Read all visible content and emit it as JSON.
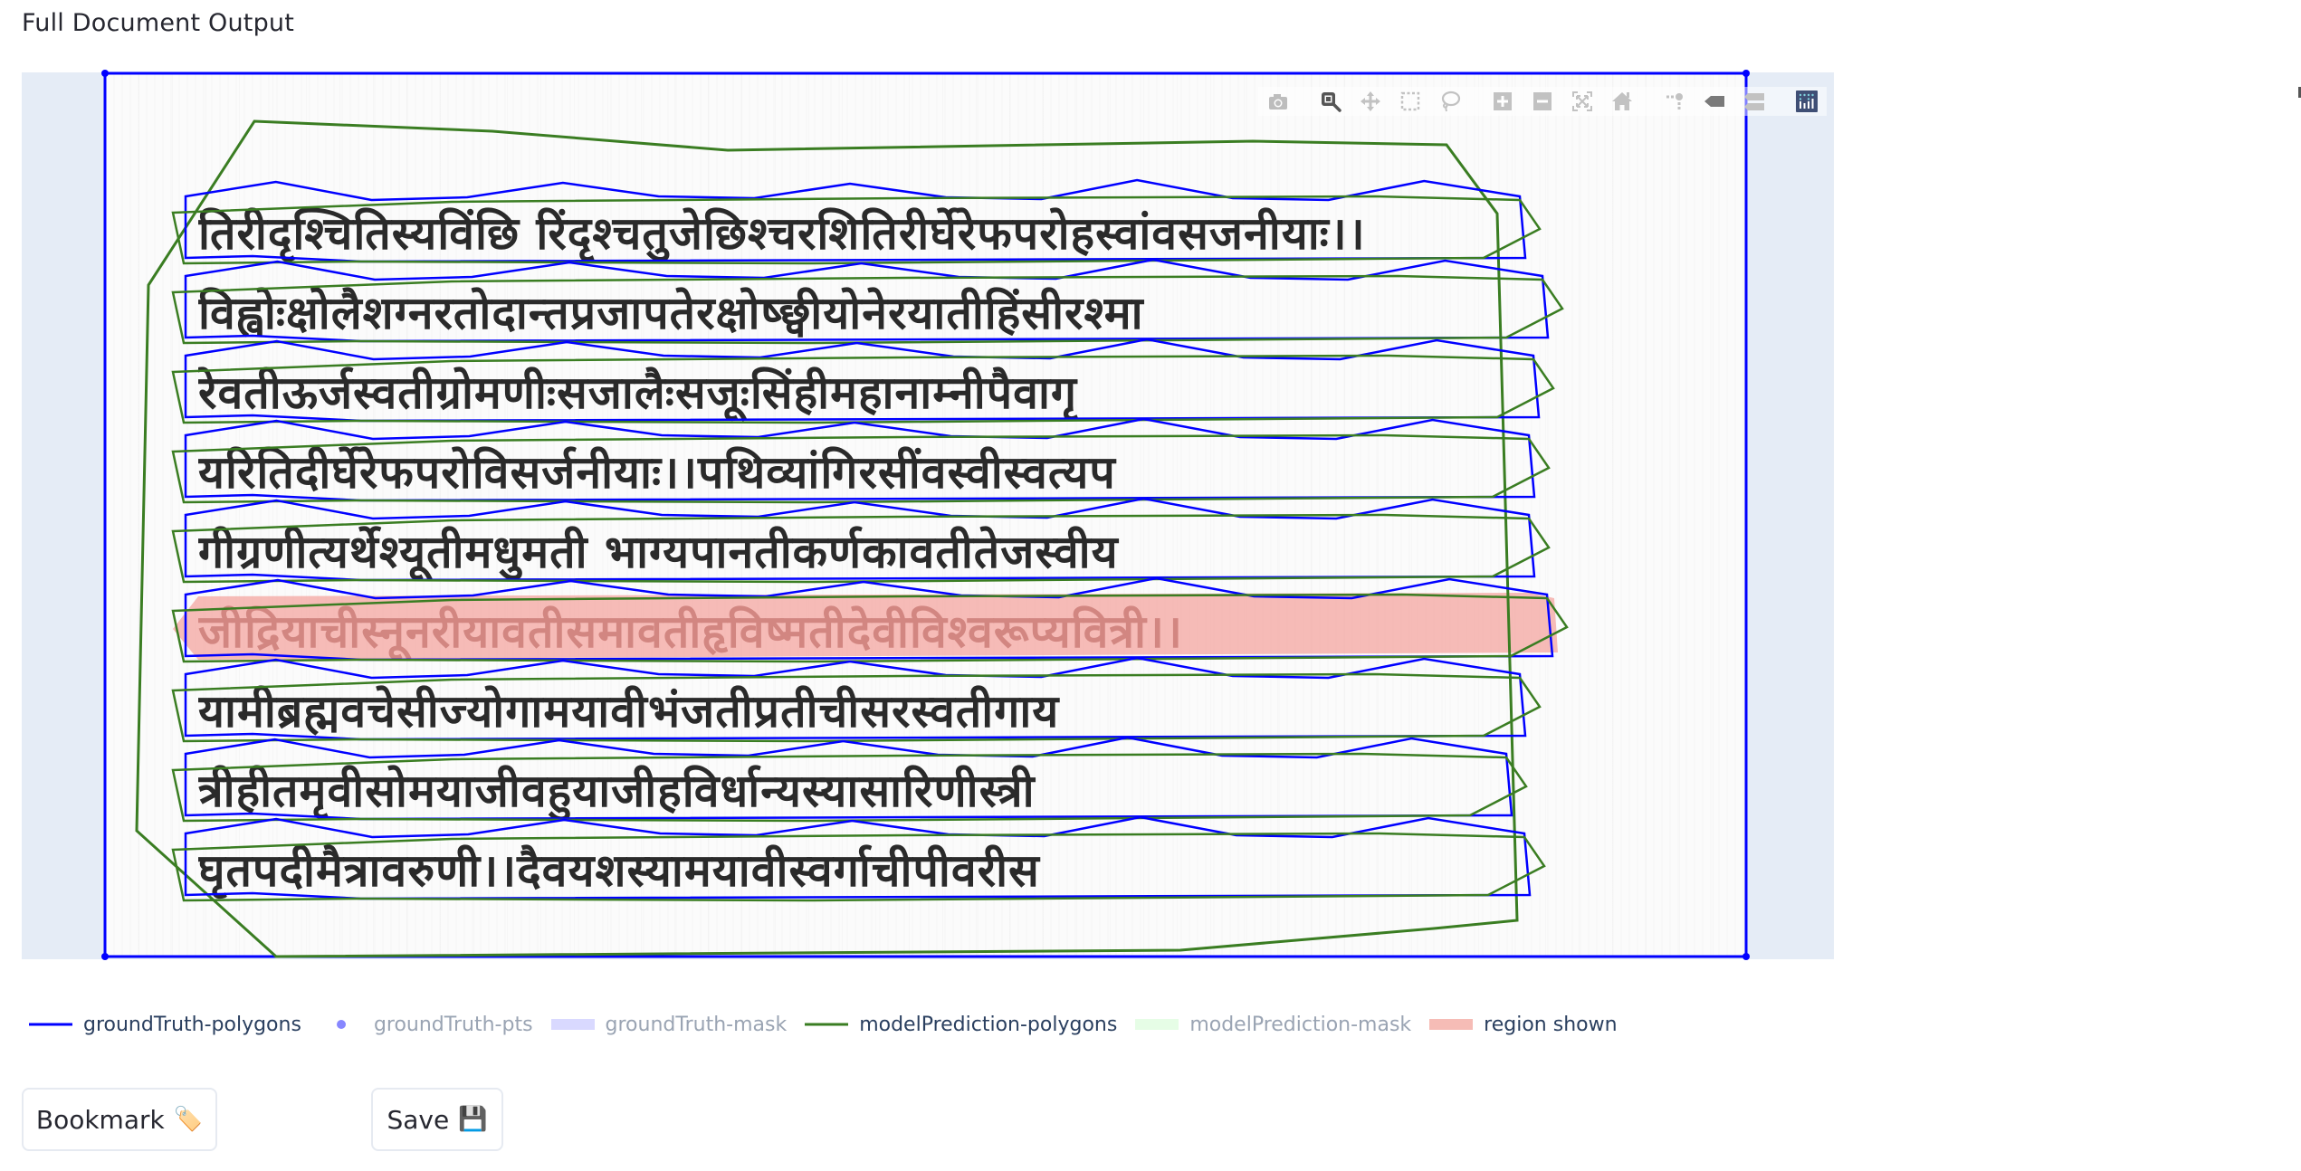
{
  "page": {
    "title": "Full Document Output"
  },
  "document": {
    "script": "Devanagari",
    "lines": [
      "तिरीदृश्चितिस्यविंछि रिंदृश्चतुजेछिश्चरशितिरीर्घेरेफपरोहस्वांवसजनीयाः।।",
      "विह्वोःक्षोलैशग्नरतोदान्तप्रजापतेरक्षोष्छ्वीयोनेरयातीहिंसीरश्मा",
      "रेवतीऊर्जस्वतीग्रोमणीःसजालैःसजूःसिंहीमहानाम्नीपैवागृ",
      "यरितिदीर्घेरेफपरोविसर्जनीयाः।।पथिव्यांगिरसींवस्वीस्वत्यप",
      "गीग्रणीत्यर्थेश्यूतीमधुमती भाग्यपानतीकर्णकावतीतेजस्वीय",
      "जीद्रियाचीस्नूनरीयावतीसमावतीहृविष्मतीदेवीविश्वरूप्यवित्री।।",
      "यामीब्रह्मवचेसीज्योगामयावीभंजतीप्रतीचीसरस्वतीगाय",
      "त्रीहीतमृवीसोमयाजीवहुयाजीहविर्धान्यस्यासारिणीस्त्री",
      "घृतपदीमैत्रावरुणी।।दैवयशस्यामयावीस्वर्गाचीपीवरीस"
    ],
    "highlighted_line_index": 5
  },
  "modebar": {
    "buttons": [
      {
        "name": "download-plot-png",
        "icon": "camera-icon",
        "active": false
      },
      {
        "name": "zoom",
        "icon": "zoom-icon",
        "active": true
      },
      {
        "name": "pan",
        "icon": "pan-icon",
        "active": false
      },
      {
        "name": "box-select",
        "icon": "box-select-icon",
        "active": false
      },
      {
        "name": "lasso-select",
        "icon": "lasso-icon",
        "active": false
      },
      {
        "name": "zoom-in",
        "icon": "zoom-in-icon",
        "active": false
      },
      {
        "name": "zoom-out",
        "icon": "zoom-out-icon",
        "active": false
      },
      {
        "name": "autoscale",
        "icon": "autoscale-icon",
        "active": false
      },
      {
        "name": "reset-axes",
        "icon": "home-icon",
        "active": false
      },
      {
        "name": "toggle-spike-lines",
        "icon": "spike-lines-icon",
        "active": false
      },
      {
        "name": "show-closest-data-on-hover",
        "icon": "hover-closest-icon",
        "active": false
      },
      {
        "name": "compare-data-on-hover",
        "icon": "hover-compare-icon",
        "active": false
      },
      {
        "name": "produced-with-plotly",
        "icon": "plotly-logo-icon",
        "active": false
      }
    ]
  },
  "legend": {
    "items": [
      {
        "label": "groundTruth-polygons",
        "type": "line",
        "color": "#0000ff",
        "visible": true
      },
      {
        "label": "groundTruth-pts",
        "type": "marker",
        "color": "#7f7fff",
        "visible": false
      },
      {
        "label": "groundTruth-mask",
        "type": "fill",
        "color": "#d6d6ff",
        "visible": false
      },
      {
        "label": "modelPrediction-polygons",
        "type": "line",
        "color": "#3a7d22",
        "visible": true
      },
      {
        "label": "modelPrediction-mask",
        "type": "fill",
        "color": "#e4fde4",
        "visible": false
      },
      {
        "label": "region shown",
        "type": "fill",
        "color": "#f4a6a0",
        "visible": true
      }
    ]
  },
  "colors": {
    "plot_background": "#e5ecf6",
    "ground_truth": "#0000ff",
    "model_prediction": "#3a7d22",
    "region_shown": "#f4a6a0"
  },
  "buttons": {
    "bookmark_label": "Bookmark",
    "bookmark_emoji": "🏷️",
    "save_label": "Save",
    "save_emoji": "💾"
  }
}
